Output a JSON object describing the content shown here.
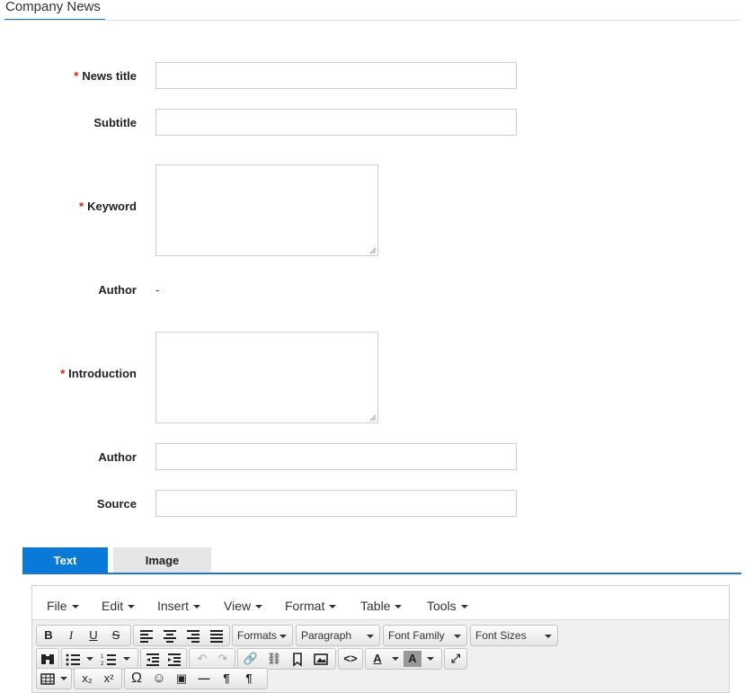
{
  "header": {
    "tab_title": "Company News"
  },
  "form": {
    "news_title": {
      "label": "News title",
      "required": "*"
    },
    "subtitle": {
      "label": "Subtitle"
    },
    "keyword": {
      "label": "Keyword",
      "required": "*"
    },
    "author_readonly": {
      "label": "Author",
      "value": "-"
    },
    "introduction": {
      "label": "Introduction",
      "required": "*"
    },
    "author": {
      "label": "Author"
    },
    "source": {
      "label": "Source"
    }
  },
  "content_tabs": [
    {
      "label": "Text"
    },
    {
      "label": "Image"
    }
  ],
  "editor": {
    "menus": [
      "File",
      "Edit",
      "Insert",
      "View",
      "Format",
      "Table",
      "Tools"
    ],
    "dropdowns": {
      "formats": "Formats",
      "paragraph": "Paragraph",
      "font_family": "Font Family",
      "font_sizes": "Font Sizes"
    }
  },
  "colors": {
    "accent": "#0a7ad8",
    "required": "#e31a1c",
    "tab_inactive": "#e6e6e6"
  }
}
